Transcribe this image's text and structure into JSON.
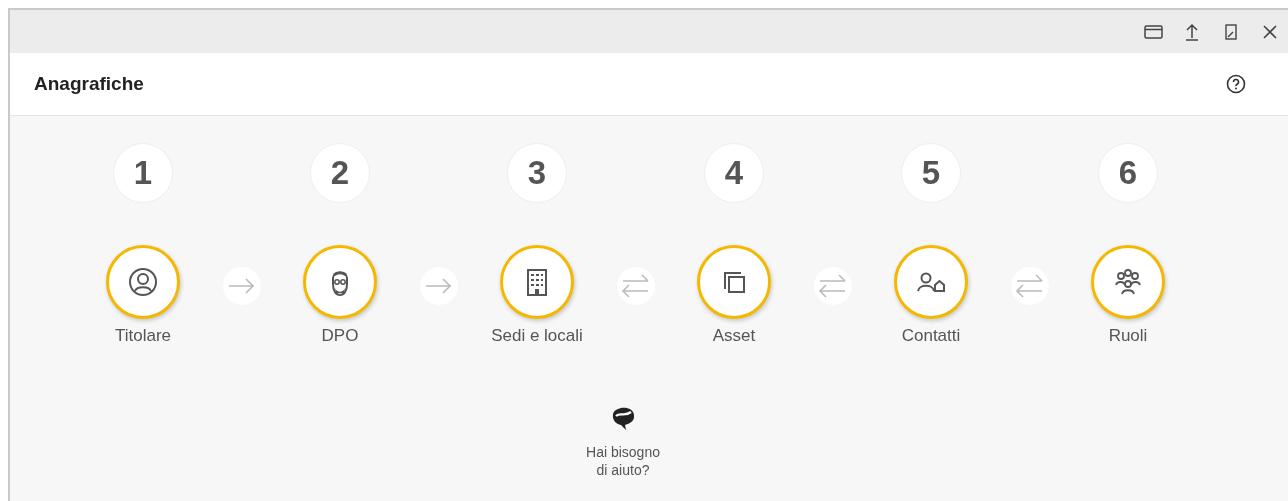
{
  "header": {
    "title": "Anagrafiche"
  },
  "steps": [
    {
      "number": "1",
      "label": "Titolare",
      "kind": "user"
    },
    {
      "number": "2",
      "label": "DPO",
      "kind": "face"
    },
    {
      "number": "3",
      "label": "Sedi e locali",
      "kind": "building"
    },
    {
      "number": "4",
      "label": "Asset",
      "kind": "copy"
    },
    {
      "number": "5",
      "label": "Contatti",
      "kind": "contact"
    },
    {
      "number": "6",
      "label": "Ruoli",
      "kind": "group"
    }
  ],
  "connectors": [
    {
      "kind": "forward"
    },
    {
      "kind": "forward"
    },
    {
      "kind": "both"
    },
    {
      "kind": "both"
    },
    {
      "kind": "both"
    }
  ],
  "help": {
    "label": "Hai bisogno di aiuto?"
  }
}
